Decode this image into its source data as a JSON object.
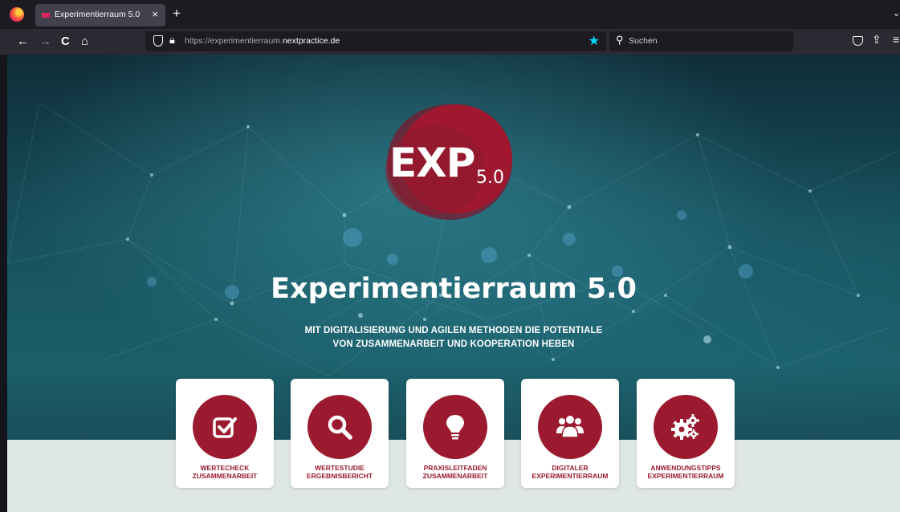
{
  "browser": {
    "tab_title": "Experimentierraum 5.0",
    "tab_close": "×",
    "new_tab": "+",
    "url_prefix": "https://experimentierraum.",
    "url_domain": "nextpractice.de",
    "search_placeholder": "Suchen",
    "nav": {
      "back": "←",
      "forward": "→",
      "reload": "C",
      "home": "⌂"
    },
    "accent_color": "#00ddff"
  },
  "hero": {
    "logo_main": "EXP",
    "logo_sub": "5.0",
    "title": "Experimentierraum 5.0",
    "subtitle_line1": "MIT DIGITALISIERUNG UND AGILEN METHODEN DIE POTENTIALE",
    "subtitle_line2": "VON ZUSAMMENARBEIT UND KOOPERATION HEBEN",
    "brand_color": "#9b1a2f"
  },
  "cards": [
    {
      "icon": "checkbox-icon",
      "line1": "WERTECHECK",
      "line2": "ZUSAMMENARBEIT"
    },
    {
      "icon": "search-icon",
      "line1": "WERTESTUDIE",
      "line2": "ERGEBNISBERICHT"
    },
    {
      "icon": "lightbulb-icon",
      "line1": "PRAXISLEITFADEN",
      "line2": "ZUSAMMENARBEIT"
    },
    {
      "icon": "users-icon",
      "line1": "DIGITALER",
      "line2": "EXPERIMENTIERRAUM"
    },
    {
      "icon": "gears-icon",
      "line1": "ANWENDUNGSTIPPS",
      "line2": "EXPERIMENTIERRAUM"
    }
  ]
}
